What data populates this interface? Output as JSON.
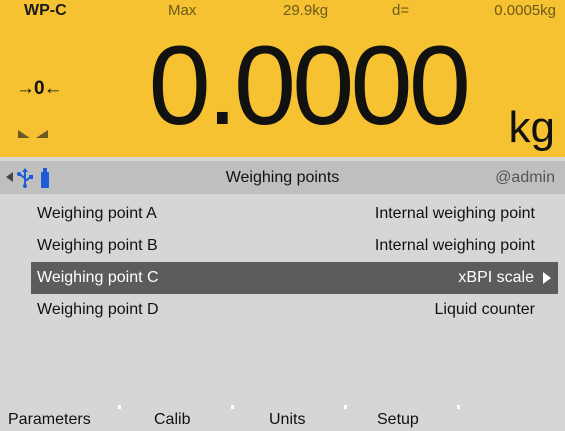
{
  "display": {
    "wp_name": "WP-C",
    "max_label": "Max",
    "max_value": "29.9kg",
    "d_label": "d=",
    "d_value": "0.0005kg",
    "weight": "0.0000",
    "unit": "kg",
    "zero_icon": "zero-indicator-icon",
    "stable_icon": "stability-indicator-icon"
  },
  "titlebar": {
    "title": "Weighing points",
    "user": "@admin"
  },
  "weighing_points": [
    {
      "name": "Weighing point A",
      "value": "Internal weighing point",
      "selected": false
    },
    {
      "name": "Weighing point B",
      "value": "Internal weighing point",
      "selected": false
    },
    {
      "name": "Weighing point C",
      "value": "xBPI scale",
      "selected": true
    },
    {
      "name": "Weighing point D",
      "value": "Liquid counter",
      "selected": false
    }
  ],
  "softkeys": [
    "Parameters",
    "Calib",
    "Units",
    "Setup"
  ],
  "colors": {
    "display_bg": "#f7c231",
    "titlebar_bg": "#bfbfbf",
    "body_bg": "#d6d6d6",
    "selected_bg": "#5c5c5c",
    "usb_blue": "#1e5bd6"
  }
}
